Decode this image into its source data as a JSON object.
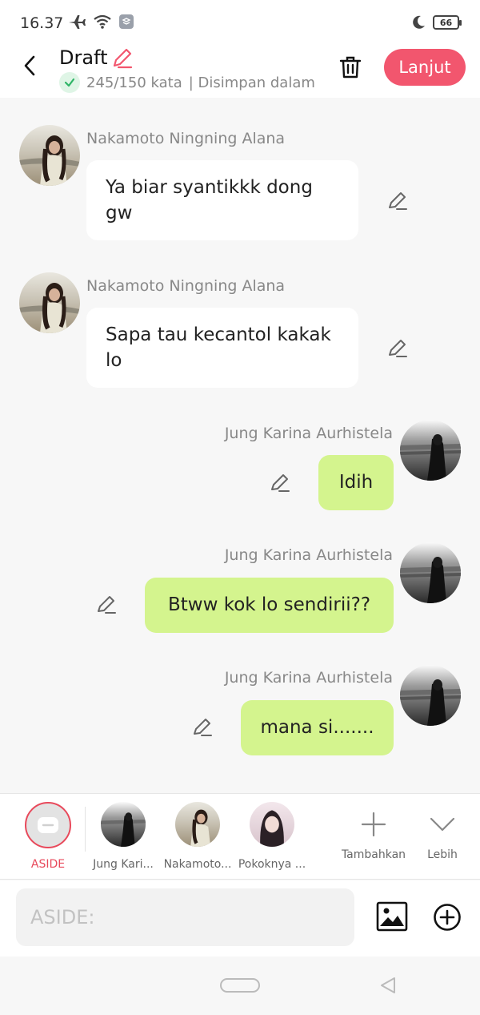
{
  "status_bar": {
    "time": "16.37",
    "battery": "66"
  },
  "header": {
    "title": "Draft",
    "word_count": "245/150 kata",
    "save_status": "| Disimpan dalam",
    "next_label": "Lanjut",
    "accent": "#f2566e"
  },
  "messages": [
    {
      "sender": "Nakamoto Ningning Alana",
      "text": "Ya biar syantikkk dong gw",
      "side": "left"
    },
    {
      "sender": "Nakamoto Ningning Alana",
      "text": "Sapa tau kecantol kakak lo",
      "side": "left"
    },
    {
      "sender": "Jung Karina Aurhistela",
      "text": "Idih",
      "side": "right"
    },
    {
      "sender": "Jung Karina Aurhistela",
      "text": "Btww kok lo sendirii??",
      "side": "right"
    },
    {
      "sender": "Jung Karina Aurhistela",
      "text": "mana si.......",
      "side": "right"
    }
  ],
  "characters": [
    {
      "label": "ASIDE"
    },
    {
      "label": "Jung Kari..."
    },
    {
      "label": "Nakamoto..."
    },
    {
      "label": "Pokoknya ..."
    }
  ],
  "actions": {
    "add_label": "Tambahkan",
    "more_label": "Lebih"
  },
  "input": {
    "placeholder": "ASIDE:"
  },
  "colors": {
    "bubble_right": "#d4f48e",
    "bubble_left": "#ffffff",
    "aside_label": "#e8495b"
  }
}
